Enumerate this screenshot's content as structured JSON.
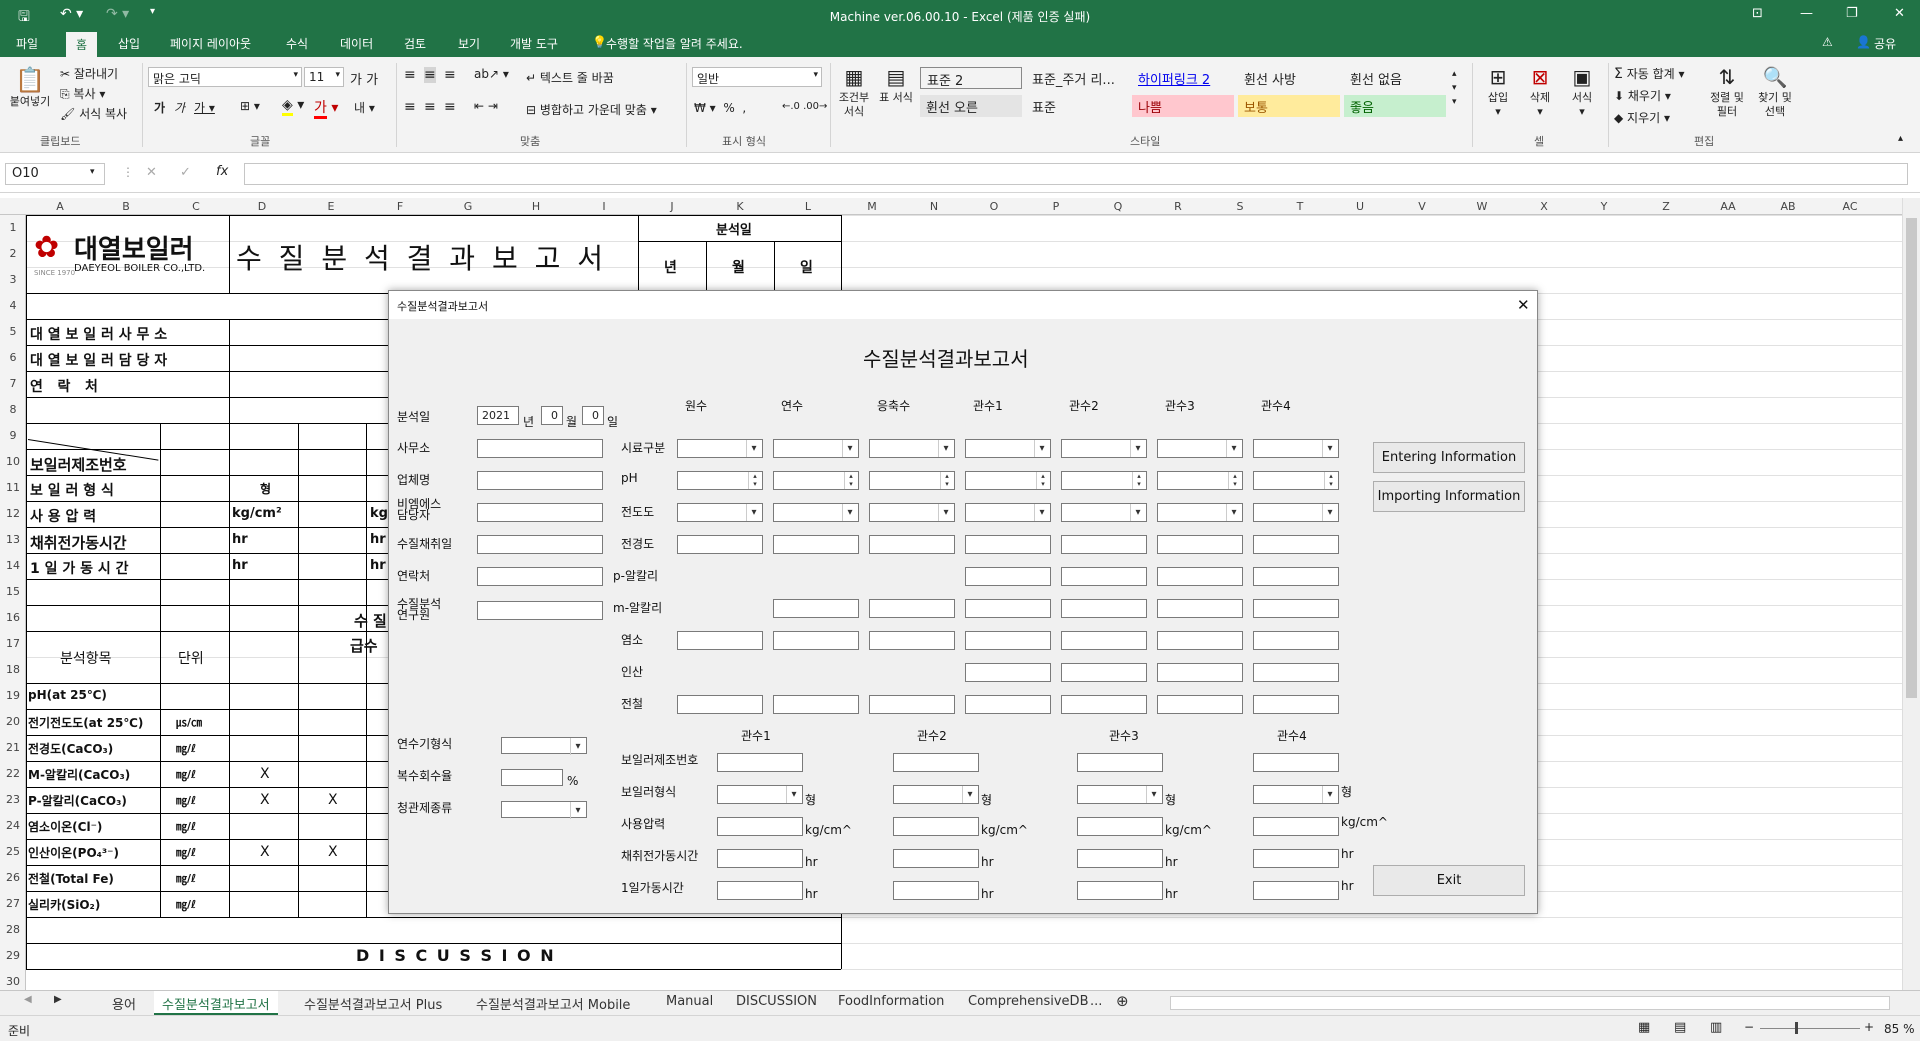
{
  "title_bar": {
    "title": "Machine ver.06.00.10 - Excel (제품 인증 실패)",
    "save_icon": "save-icon",
    "undo_icon": "undo-icon",
    "redo_icon": "redo-icon"
  },
  "tabs": [
    "파일",
    "홈",
    "삽입",
    "페이지 레이아웃",
    "수식",
    "데이터",
    "검토",
    "보기",
    "개발 도구"
  ],
  "active_tab": "홈",
  "tell_me": "수행할 작업을 알려 주세요.",
  "share": "공유",
  "ribbon": {
    "paste": "붙여넣기",
    "cut": "잘라내기",
    "copy": "복사",
    "format_painter": "서식 복사",
    "clipboard_label": "클립보드",
    "font_name": "맑은 고딕",
    "font_size": "11",
    "font_label": "글꼴",
    "wrap_text": "텍스트 줄 바꿈",
    "merge_center": "병합하고 가운데 맞춤",
    "align_label": "맞춤",
    "number_format": "일반",
    "number_label": "표시 형식",
    "cond_format": "조건부 서식",
    "table_format": "표 서식",
    "styles": [
      {
        "name": "표준 2",
        "color": "#ffffff",
        "fg": "#000000"
      },
      {
        "name": "표준_주거 리...",
        "color": "#f3f3f3",
        "fg": "#000000"
      },
      {
        "name": "하이퍼링크 2",
        "color": "#f3f3f3",
        "fg": "#0000ee"
      },
      {
        "name": "휜선 사방",
        "color": "#f3f3f3",
        "fg": "#000000"
      },
      {
        "name": "휜선 없음",
        "color": "#f3f3f3",
        "fg": "#000000"
      },
      {
        "name": "휜선 오른",
        "color": "#e4e4e4",
        "fg": "#000000"
      },
      {
        "name": "표준",
        "color": "#f3f3f3",
        "fg": "#000000"
      },
      {
        "name": "나쁨",
        "color": "#ffc7ce",
        "fg": "#9c0006"
      },
      {
        "name": "보통",
        "color": "#ffeb9c",
        "fg": "#9c5700"
      },
      {
        "name": "좋음",
        "color": "#c6efce",
        "fg": "#006100"
      }
    ],
    "style_label": "스타일",
    "insert": "삽입",
    "delete": "삭제",
    "format": "서식",
    "cells_label": "셀",
    "autosum": "자동 합계",
    "fill": "채우기",
    "clear": "지우기",
    "sort_filter": "정렬 및 필터",
    "find_select": "찾기 및 선택",
    "edit_label": "편집"
  },
  "name_box": "O10",
  "formula_fx": "fx",
  "columns": [
    "A",
    "B",
    "C",
    "D",
    "E",
    "F",
    "G",
    "H",
    "I",
    "J",
    "K",
    "L",
    "M",
    "N",
    "O",
    "P",
    "Q",
    "R",
    "S",
    "T",
    "U",
    "V",
    "W",
    "X",
    "Y",
    "Z",
    "AA",
    "AB",
    "AC"
  ],
  "rows": [
    "1",
    "2",
    "3",
    "4",
    "5",
    "6",
    "7",
    "8",
    "9",
    "10",
    "11",
    "12",
    "13",
    "14",
    "15",
    "16",
    "17",
    "18",
    "19",
    "20",
    "21",
    "22",
    "23",
    "24",
    "25",
    "26",
    "27",
    "28",
    "29",
    "30"
  ],
  "sheet": {
    "company_kr": "대열보일러",
    "company_en": "DAEYEOL BOILER CO.,LTD.",
    "since": "SINCE 1970",
    "report_title": "수 질 분 석 결 과 보 고 서",
    "analysis_date": "분석일",
    "year": "년",
    "month": "월",
    "day": "일",
    "office": "대 열 보 일 러 사 무 소",
    "manager": "대 열 보 일 러 담 당 자",
    "contact": "연   락   처",
    "serial": "보일러제조번호",
    "boiler_type": "보 일 러 형 식",
    "type_unit": "형",
    "pressure": "사  용  압  력",
    "pressure_unit": "kg/cm²",
    "pressure_unit2": "kg/",
    "sampling_hours": "채취전가동시간",
    "daily_hours": "1 일 가 동 시 간",
    "hr": "hr",
    "quality_partial": "수  질",
    "supply_partial": "급수",
    "item_header": "분석항목",
    "unit_header": "단위",
    "items": [
      {
        "name": "pH(at 25℃)",
        "unit": "",
        "d": "",
        "e": ""
      },
      {
        "name": "전기전도도(at 25℃)",
        "unit": "㎲/㎝",
        "d": "",
        "e": ""
      },
      {
        "name": "전경도(CaCO₃)",
        "unit": "㎎/ℓ",
        "d": "",
        "e": ""
      },
      {
        "name": "M-알칼리(CaCO₃)",
        "unit": "㎎/ℓ",
        "d": "X",
        "e": ""
      },
      {
        "name": "P-알칼리(CaCO₃)",
        "unit": "㎎/ℓ",
        "d": "X",
        "e": "X"
      },
      {
        "name": "염소이온(Cl⁻)",
        "unit": "㎎/ℓ",
        "d": "",
        "e": ""
      },
      {
        "name": "인산이온(PO₄³⁻)",
        "unit": "㎎/ℓ",
        "d": "X",
        "e": "X"
      },
      {
        "name": "전철(Total Fe)",
        "unit": "㎎/ℓ",
        "d": "",
        "e": ""
      },
      {
        "name": "실리카(SiO₂)",
        "unit": "㎎/ℓ",
        "d": "",
        "e": ""
      }
    ],
    "discussion": "D I S C U S S I O N"
  },
  "sheet_tabs": [
    "용어",
    "수질분석결과보고서",
    "수질분석결과보고서 Plus",
    "수질분석결과보고서 Mobile",
    "Manual",
    "DISCUSSION",
    "FoodInformation",
    "ComprehensiveDB",
    "..."
  ],
  "active_sheet": "수질분석결과보고서",
  "status": {
    "ready": "준비",
    "zoom": "85 %"
  },
  "dialog": {
    "window_title": "수질분석결과보고서",
    "heading": "수질분석결과보고서",
    "date_label": "분석일",
    "year_value": "2021",
    "year_unit": "년",
    "month_value": "0",
    "month_unit": "월",
    "day_value": "0",
    "day_unit": "일",
    "left_labels": [
      "사무소",
      "업체명",
      "비엠에스\n담당자",
      "수질채취일",
      "연락처",
      "수질분석\n연구원"
    ],
    "col_headers": [
      "원수",
      "연수",
      "응축수",
      "관수1",
      "관수2",
      "관수3",
      "관수4"
    ],
    "row_labels": [
      "시료구분",
      "pH",
      "전도도",
      "전경도",
      "p-알칼리",
      "m-알칼리",
      "염소",
      "인산",
      "전철"
    ],
    "softener_type": "연수기형식",
    "recovery_rate": "복수회수율",
    "percent": "%",
    "cleaner_type": "청관제종류",
    "boiler_headers": [
      "관수1",
      "관수2",
      "관수3",
      "관수4"
    ],
    "boiler_labels": [
      "보일러제조번호",
      "보일러형식",
      "사용압력",
      "채취전가동시간",
      "1일가동시간"
    ],
    "unit_type": "형",
    "unit_pressure": "kg/cm^",
    "unit_hr": "hr",
    "btn_entering": "Entering Information",
    "btn_importing": "Importing Information",
    "btn_exit": "Exit",
    "close": "✕"
  }
}
